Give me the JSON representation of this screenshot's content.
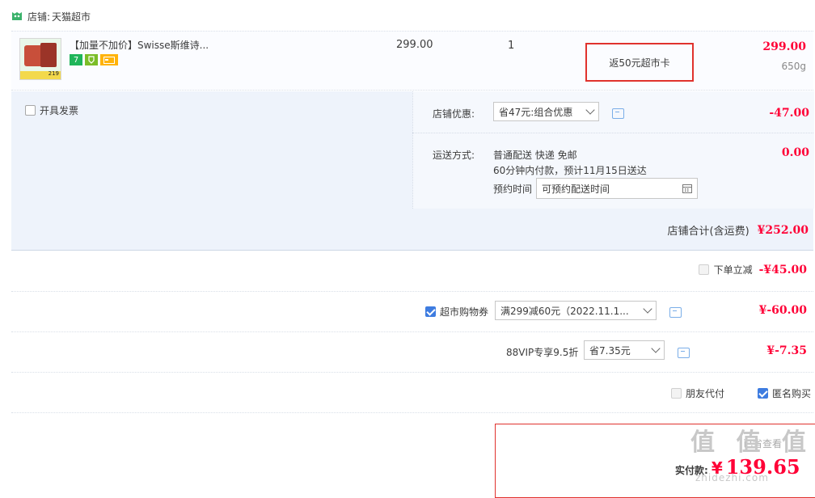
{
  "store": {
    "label": "店铺:",
    "name": "天猫超市"
  },
  "item": {
    "title": "【加量不加价】Swisse斯维诗...",
    "thumb_tag": "219",
    "badge1": "7",
    "price": "299.00",
    "quantity": "1",
    "promo": "返50元超市卡",
    "total": "299.00",
    "weight": "650g"
  },
  "invoice": {
    "label": "开具发票"
  },
  "store_discount": {
    "label": "店铺优惠:",
    "value": "省47元:组合优惠",
    "amount": "-47.00"
  },
  "shipping": {
    "label": "运送方式:",
    "line1": "普通配送 快递 免邮",
    "line2": "60分钟内付款，预计11月15日送达",
    "reserve_label": "预约时间",
    "reserve_placeholder": "可预约配送时间",
    "amount": "0.00"
  },
  "store_total": {
    "label": "店铺合计(含运费)",
    "amount": "¥252.00"
  },
  "instant_discount": {
    "label": "下单立减",
    "amount": "-¥45.00"
  },
  "coupon": {
    "label": "超市购物券",
    "value": "满299减60元（2022.11.1...",
    "amount": "¥-60.00"
  },
  "vip": {
    "label": "88VIP专享9.5折",
    "value": "省7.35元",
    "amount": "¥-7.35"
  },
  "options": {
    "friend_pay": "朋友代付",
    "anonymous": "匿名购买"
  },
  "pay": {
    "label": "实付款:",
    "currency": "¥",
    "amount": "139.65",
    "watermark": "值 值 值",
    "watermark_url": "zhidezhi.com",
    "hint": "已省查看"
  },
  "colors": {
    "accent": "#ff0036",
    "link": "#3e7ce0",
    "highlight_border": "#e0322d"
  }
}
